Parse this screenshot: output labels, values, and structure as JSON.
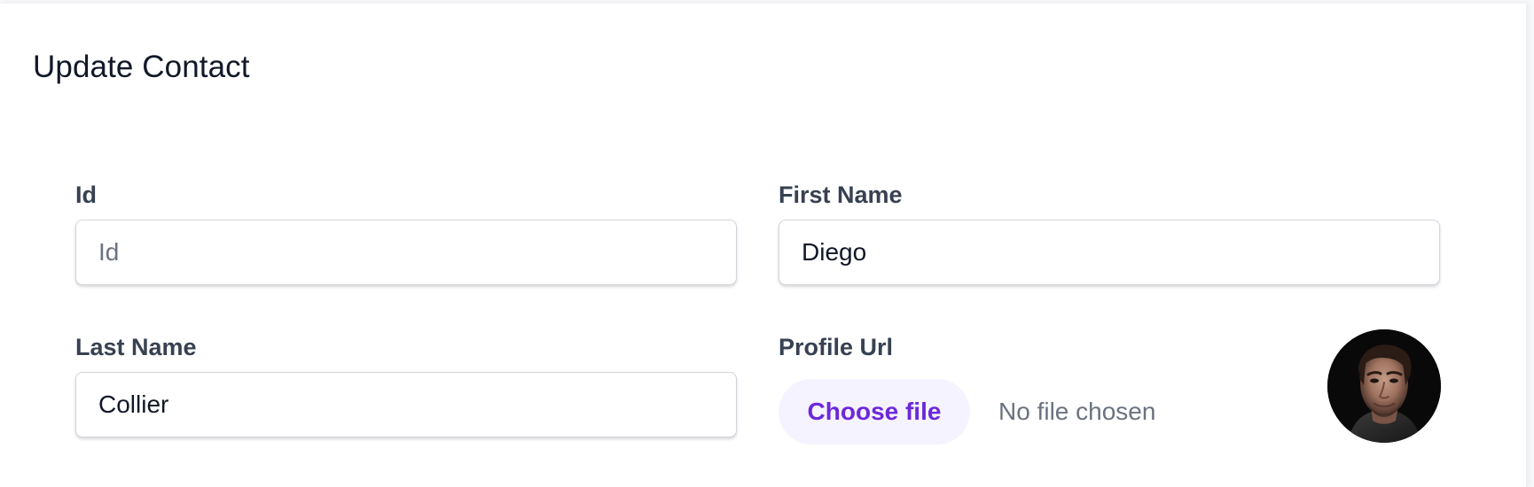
{
  "form": {
    "title": "Update Contact",
    "fields": {
      "id": {
        "label": "Id",
        "value": "",
        "placeholder": "Id"
      },
      "first_name": {
        "label": "First Name",
        "value": "Diego",
        "placeholder": ""
      },
      "last_name": {
        "label": "Last Name",
        "value": "Collier",
        "placeholder": ""
      },
      "profile_url": {
        "label": "Profile Url",
        "button_label": "Choose file",
        "status": "No file chosen"
      }
    },
    "avatar": {
      "icon": "contact-avatar-photo"
    }
  },
  "colors": {
    "title": "#111827",
    "label": "#374151",
    "input_border": "#d1d5db",
    "file_button_bg": "#f5f3ff",
    "file_button_text": "#6d28d9",
    "muted_text": "#6b7280"
  }
}
